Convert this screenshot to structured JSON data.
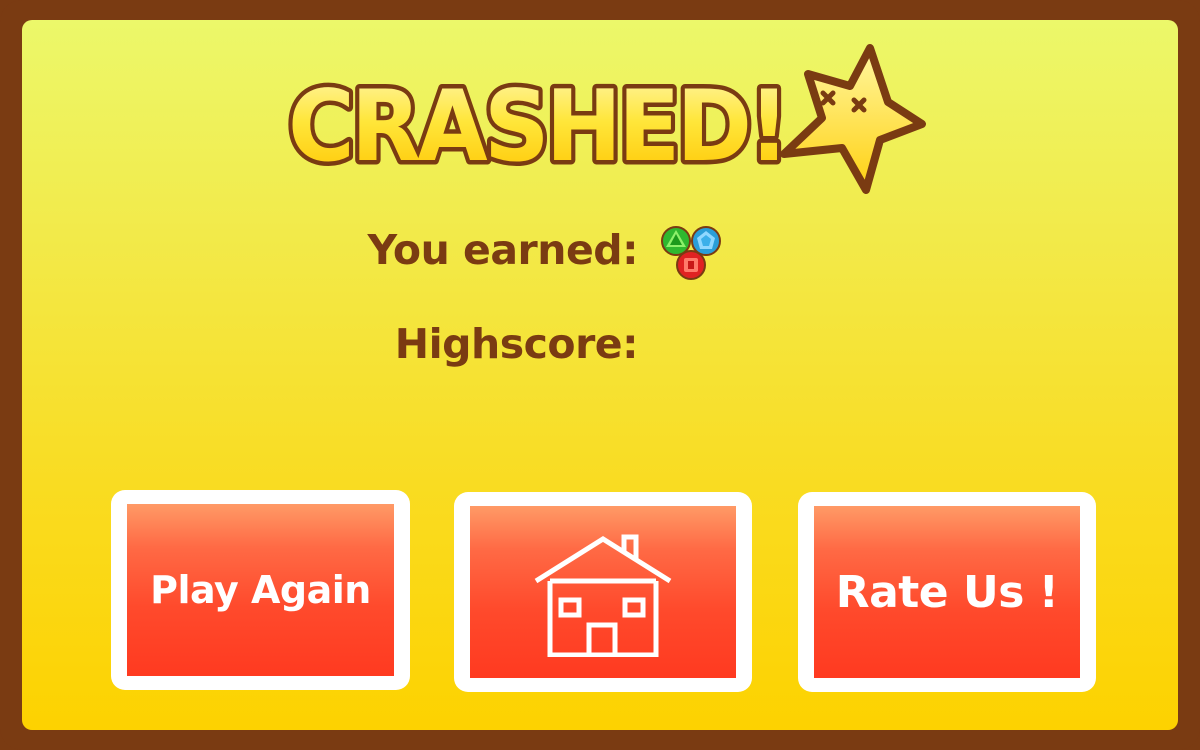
{
  "dialog": {
    "title": "CRASHED!",
    "title_icon": "dizzy-star-icon",
    "earned_label": "You earned:",
    "earned_gems": [
      "green-gem-icon",
      "blue-gem-icon",
      "red-gem-icon"
    ],
    "highscore_label": "Highscore:"
  },
  "buttons": {
    "play_again": "Play Again",
    "home_icon": "house-icon",
    "rate_us": "Rate Us !"
  },
  "colors": {
    "frame": "#7a3b12",
    "panel_top": "#ecf86a",
    "panel_bottom": "#fdd200",
    "button": "#ff4a2c",
    "title_fill": "#ffd21a"
  }
}
